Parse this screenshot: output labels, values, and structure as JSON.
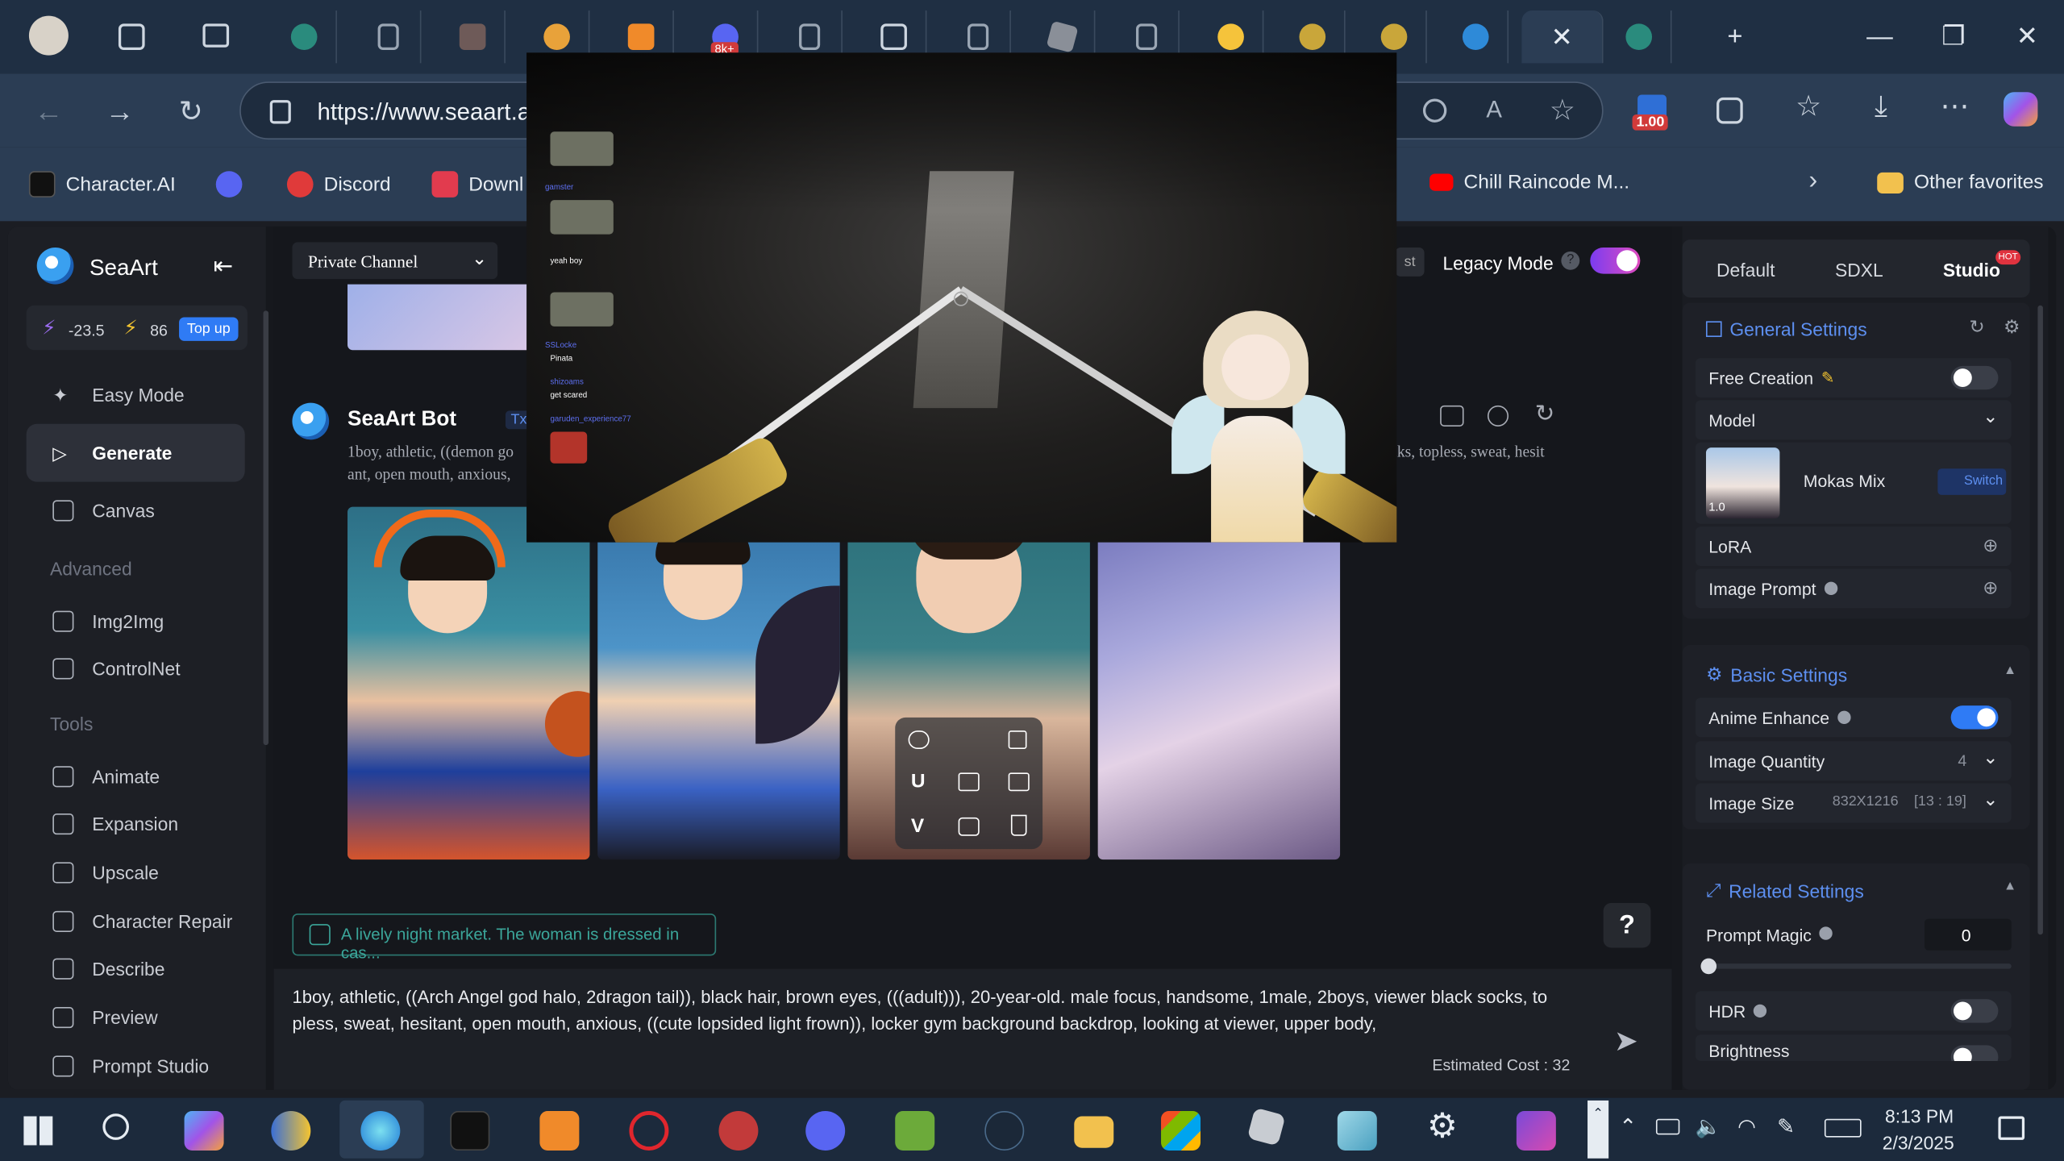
{
  "browser": {
    "url": "https://www.seaart.ai",
    "favorites": [
      {
        "label": "Character.AI",
        "color": "#1a1a1a"
      },
      {
        "label": "Discord",
        "color": "#5865f2"
      },
      {
        "label": "Discord",
        "color": "#e03a3a"
      },
      {
        "label": "Downl",
        "color": "#e23b4e"
      },
      {
        "label": "Chill Raincode M...",
        "color": "#ff0000"
      }
    ],
    "other_favorites": "Other favorites",
    "badge": "1.00",
    "tab_badge": "8k+"
  },
  "sidebar": {
    "brand": "SeaArt",
    "credits_a": "-23.5",
    "credits_b": "86",
    "topup": "Top up",
    "items_top": [
      "Easy Mode",
      "Generate",
      "Canvas"
    ],
    "advanced_heading": "Advanced",
    "items_advanced": [
      "Img2Img",
      "ControlNet"
    ],
    "tools_heading": "Tools",
    "items_tools": [
      "Animate",
      "Expansion",
      "Upscale",
      "Character Repair",
      "Describe",
      "Preview",
      "Prompt Studio"
    ]
  },
  "main": {
    "channel": "Private Channel",
    "legacy_label": "Legacy Mode",
    "bot_name": "SeaArt Bot",
    "bot_tag": "Txt2Img",
    "bot_prompt_l1": "1boy, athletic, ((demon go",
    "bot_prompt_l1_right": "cks, topless, sweat, hesit",
    "bot_prompt_l2": "ant, open mouth, anxious,",
    "overlay_buttons": [
      "U",
      "V"
    ],
    "suggestion": "A lively night market. The woman is dressed in cas...",
    "help": "?",
    "prompt_line1": "1boy, athletic, ((Arch Angel god halo, 2dragon tail)), black hair, brown eyes, (((adult))), 20-year-old. male focus, handsome, 1male, 2boys, viewer black socks, to",
    "prompt_line2": "pless, sweat, hesitant, open mouth, anxious, ((cute lopsided light frown)), locker gym background backdrop, looking at viewer, upper body,",
    "cost": "Estimated Cost : 32",
    "ghost_btn": "st"
  },
  "right": {
    "tabs": [
      "Default",
      "SDXL",
      "Studio"
    ],
    "hot": "HOT",
    "general": "General Settings",
    "free_creation": "Free Creation",
    "model_label": "Model",
    "model_name": "Mokas Mix",
    "model_version": "1.0",
    "switch": "Switch",
    "lora": "LoRA",
    "image_prompt": "Image Prompt",
    "basic": "Basic Settings",
    "anime_enhance": "Anime Enhance",
    "image_quantity": "Image Quantity",
    "image_quantity_val": "4",
    "image_size": "Image Size",
    "image_size_val": "832X1216",
    "image_ratio": "[13 : 19]",
    "related": "Related Settings",
    "prompt_magic": "Prompt Magic",
    "prompt_magic_val": "0",
    "hdr": "HDR",
    "brightness": "Brightness"
  },
  "stream": {
    "chat": [
      "gamster",
      "yeah boy",
      "SSLocke",
      "Pinata",
      "shizoams",
      "get scared",
      "garuden_experience77"
    ]
  },
  "taskbar": {
    "time": "8:13 PM",
    "date": "2/3/2025"
  }
}
